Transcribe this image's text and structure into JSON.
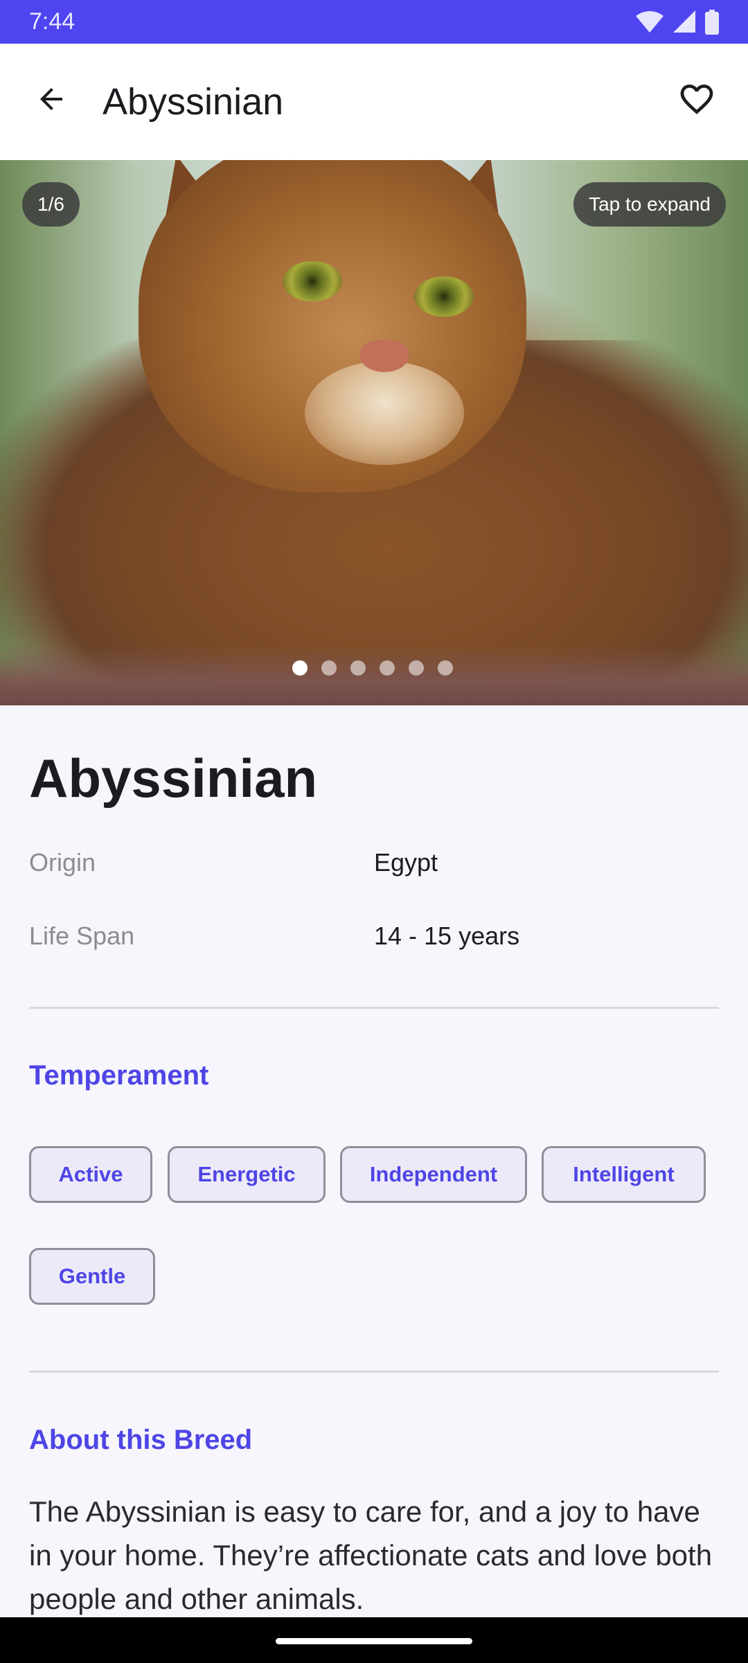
{
  "status_bar": {
    "time": "7:44",
    "icons": [
      "wifi-icon",
      "signal-icon",
      "battery-icon"
    ],
    "background": "#4e45f0"
  },
  "top_bar": {
    "title": "Abyssinian",
    "back_icon": "arrow-back-icon",
    "favorite_icon": "heart-outline-icon"
  },
  "gallery": {
    "counter": "1/6",
    "expand_hint": "Tap to expand",
    "total_images": 6,
    "current_index": 1
  },
  "breed": {
    "name": "Abyssinian",
    "info": [
      {
        "label": "Origin",
        "value": "Egypt"
      },
      {
        "label": "Life Span",
        "value": "14 - 15 years"
      }
    ]
  },
  "temperament": {
    "title": "Temperament",
    "chips": [
      "Active",
      "Energetic",
      "Independent",
      "Intelligent",
      "Gentle"
    ]
  },
  "about": {
    "title": "About this Breed",
    "text": "The Abyssinian is easy to care for, and a joy to have in your home. They’re affectionate cats and love both people and other animals."
  },
  "colors": {
    "accent": "#4e45e6",
    "background": "#f6f6fc"
  }
}
